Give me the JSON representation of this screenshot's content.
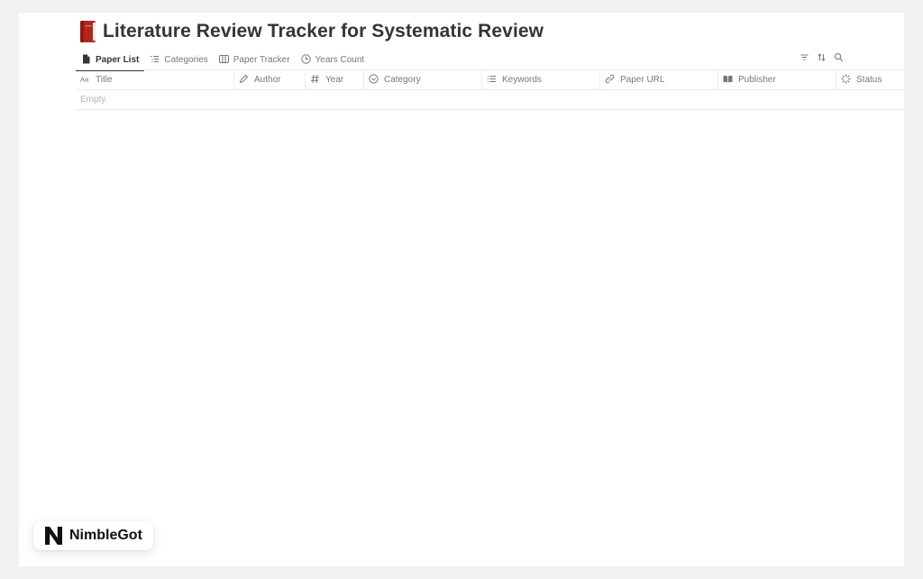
{
  "page": {
    "title": "Literature Review Tracker for Systematic Review",
    "icon": "red-book-icon"
  },
  "tabs": [
    {
      "label": "Paper List",
      "icon": "document-icon",
      "active": true
    },
    {
      "label": "Categories",
      "icon": "list-icon",
      "active": false
    },
    {
      "label": "Paper Tracker",
      "icon": "board-icon",
      "active": false
    },
    {
      "label": "Years Count",
      "icon": "clock-chart-icon",
      "active": false
    }
  ],
  "toolbar": {
    "filter_icon": "filter-icon",
    "sort_icon": "sort-icon",
    "search_icon": "search-icon"
  },
  "table": {
    "columns": [
      {
        "label": "Title",
        "icon": "text-property-icon"
      },
      {
        "label": "Author",
        "icon": "pencil-icon"
      },
      {
        "label": "Year",
        "icon": "number-icon"
      },
      {
        "label": "Category",
        "icon": "select-icon"
      },
      {
        "label": "Keywords",
        "icon": "multi-select-icon"
      },
      {
        "label": "Paper URL",
        "icon": "link-icon"
      },
      {
        "label": "Publisher",
        "icon": "open-book-icon"
      },
      {
        "label": "Status",
        "icon": "status-icon"
      }
    ],
    "empty_text": "Empty."
  },
  "brand": {
    "name": "NimbleGot",
    "logo": "nimblegot-logo"
  },
  "colors": {
    "background": "#f1f1f1",
    "text": "#37352f",
    "muted_text": "#787774",
    "book_red": "#c0392b"
  }
}
